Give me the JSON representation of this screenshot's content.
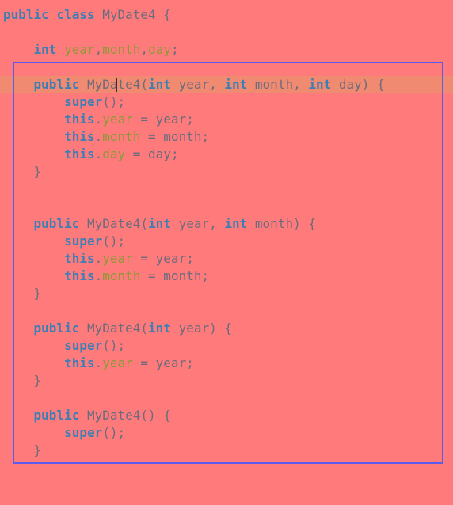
{
  "colors": {
    "background": "#ff7b7b",
    "keyword": "#3a7fb5",
    "field": "#8a9a36",
    "text": "#6b6b7e",
    "selection_border": "#5b5bef",
    "current_line": "#f08a70"
  },
  "code_lines": [
    [
      [
        "kw",
        "public"
      ],
      [
        "tx",
        " "
      ],
      [
        "kw",
        "class"
      ],
      [
        "tx",
        " MyDate4 {"
      ]
    ],
    [],
    [
      [
        "tx",
        "    "
      ],
      [
        "kw",
        "int"
      ],
      [
        "tx",
        " "
      ],
      [
        "fld",
        "year"
      ],
      [
        "tx",
        ","
      ],
      [
        "fld",
        "month"
      ],
      [
        "tx",
        ","
      ],
      [
        "fld",
        "day"
      ],
      [
        "tx",
        ";"
      ]
    ],
    [],
    [
      [
        "tx",
        "    "
      ],
      [
        "kw",
        "public"
      ],
      [
        "tx",
        " MyDate4("
      ],
      [
        "kw",
        "int"
      ],
      [
        "tx",
        " year, "
      ],
      [
        "kw",
        "int"
      ],
      [
        "tx",
        " month, "
      ],
      [
        "kw",
        "int"
      ],
      [
        "tx",
        " day) {"
      ]
    ],
    [
      [
        "tx",
        "        "
      ],
      [
        "kw",
        "super"
      ],
      [
        "tx",
        "();"
      ]
    ],
    [
      [
        "tx",
        "        "
      ],
      [
        "kw",
        "this"
      ],
      [
        "tx",
        "."
      ],
      [
        "fld",
        "year"
      ],
      [
        "tx",
        " = year;"
      ]
    ],
    [
      [
        "tx",
        "        "
      ],
      [
        "kw",
        "this"
      ],
      [
        "tx",
        "."
      ],
      [
        "fld",
        "month"
      ],
      [
        "tx",
        " = month;"
      ]
    ],
    [
      [
        "tx",
        "        "
      ],
      [
        "kw",
        "this"
      ],
      [
        "tx",
        "."
      ],
      [
        "fld",
        "day"
      ],
      [
        "tx",
        " = day;"
      ]
    ],
    [
      [
        "tx",
        "    }"
      ]
    ],
    [],
    [],
    [
      [
        "tx",
        "    "
      ],
      [
        "kw",
        "public"
      ],
      [
        "tx",
        " MyDate4("
      ],
      [
        "kw",
        "int"
      ],
      [
        "tx",
        " year, "
      ],
      [
        "kw",
        "int"
      ],
      [
        "tx",
        " month) {"
      ]
    ],
    [
      [
        "tx",
        "        "
      ],
      [
        "kw",
        "super"
      ],
      [
        "tx",
        "();"
      ]
    ],
    [
      [
        "tx",
        "        "
      ],
      [
        "kw",
        "this"
      ],
      [
        "tx",
        "."
      ],
      [
        "fld",
        "year"
      ],
      [
        "tx",
        " = year;"
      ]
    ],
    [
      [
        "tx",
        "        "
      ],
      [
        "kw",
        "this"
      ],
      [
        "tx",
        "."
      ],
      [
        "fld",
        "month"
      ],
      [
        "tx",
        " = month;"
      ]
    ],
    [
      [
        "tx",
        "    }"
      ]
    ],
    [],
    [
      [
        "tx",
        "    "
      ],
      [
        "kw",
        "public"
      ],
      [
        "tx",
        " MyDate4("
      ],
      [
        "kw",
        "int"
      ],
      [
        "tx",
        " year) {"
      ]
    ],
    [
      [
        "tx",
        "        "
      ],
      [
        "kw",
        "super"
      ],
      [
        "tx",
        "();"
      ]
    ],
    [
      [
        "tx",
        "        "
      ],
      [
        "kw",
        "this"
      ],
      [
        "tx",
        "."
      ],
      [
        "fld",
        "year"
      ],
      [
        "tx",
        " = year;"
      ]
    ],
    [
      [
        "tx",
        "    }"
      ]
    ],
    [],
    [
      [
        "tx",
        "    "
      ],
      [
        "kw",
        "public"
      ],
      [
        "tx",
        " MyDate4() {"
      ]
    ],
    [
      [
        "tx",
        "        "
      ],
      [
        "kw",
        "super"
      ],
      [
        "tx",
        "();"
      ]
    ],
    [
      [
        "tx",
        "    }"
      ]
    ]
  ]
}
